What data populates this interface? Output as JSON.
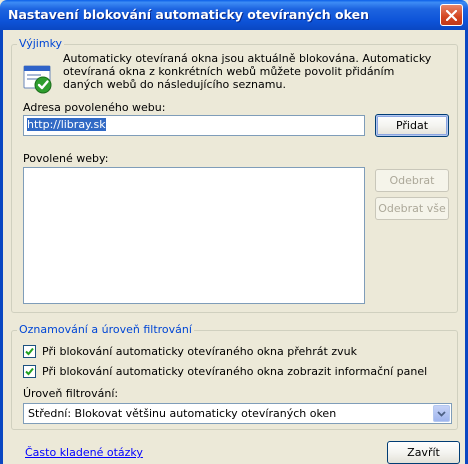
{
  "window": {
    "title": "Nastavení blokování automaticky otevíraných oken"
  },
  "exceptions": {
    "group_label": "Výjimky",
    "info_text": "Automaticky otevíraná okna jsou aktuálně blokována. Automaticky otevíraná okna z konkrétních webů můžete povolit přidáním daných webů do následujícího seznamu.",
    "address_label": "Adresa povoleného webu:",
    "address_value": "http://libray.sk",
    "add_button": "Přidat",
    "allowed_label": "Povolené weby:",
    "allowed_sites": [],
    "remove_button": "Odebrat",
    "remove_all_button": "Odebrat vše"
  },
  "notifications": {
    "group_label": "Oznamování a úroveň filtrování",
    "play_sound_label": "Při blokování automaticky otevíraného okna přehrát zvuk",
    "play_sound_checked": true,
    "show_bar_label": "Při blokování automaticky otevíraného okna zobrazit informační panel",
    "show_bar_checked": true,
    "filter_level_label": "Úroveň filtrování:",
    "filter_level_value": "Střední: Blokovat většinu automaticky otevíraných oken"
  },
  "footer": {
    "faq_link": "Často kladené otázky",
    "close_button": "Zavřít"
  },
  "colors": {
    "titlebar": "#0a5fe8",
    "group_label": "#0046d5",
    "dialog_bg": "#ece9d8",
    "selection": "#316ac5"
  },
  "icons": {
    "info": "popup-blocker-icon",
    "close": "close-icon",
    "dropdown": "chevron-down-icon",
    "check": "check-icon"
  }
}
